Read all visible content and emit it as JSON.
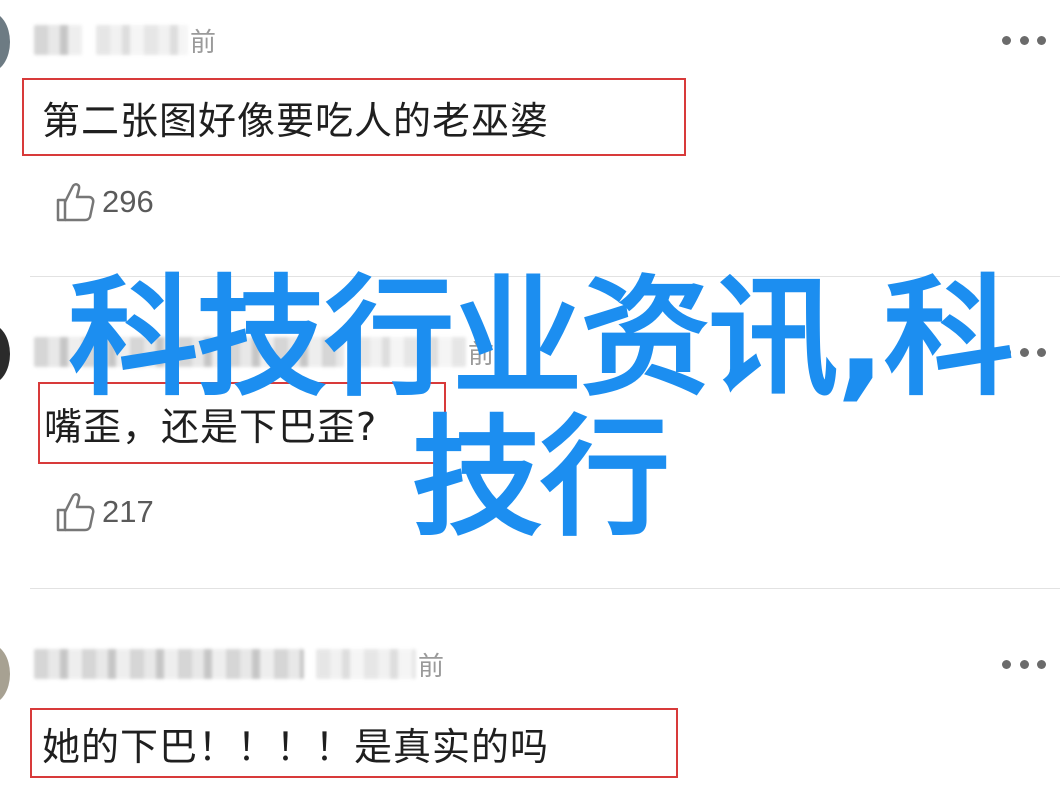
{
  "comments": [
    {
      "time_suffix": "前",
      "text": "第二张图好像要吃人的老巫婆",
      "likes": "296"
    },
    {
      "time_suffix": "前",
      "text": "嘴歪，还是下巴歪?",
      "likes": "217"
    },
    {
      "time_suffix": "前",
      "text": "她的下巴！！！！是真实的吗"
    }
  ],
  "watermark": {
    "text": "科技行业资讯,科技行"
  },
  "icons": {
    "more": "more-dots-icon",
    "like": "thumbs-up-icon"
  },
  "colors": {
    "highlight_border": "#d83a3a",
    "watermark": "#1c8ef0"
  }
}
